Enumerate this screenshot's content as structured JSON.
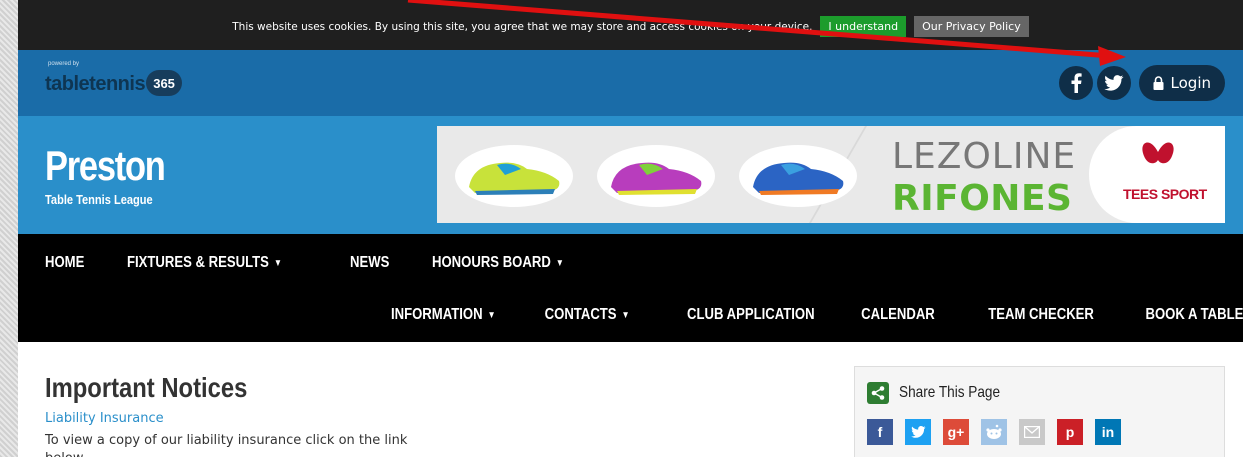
{
  "cookie_bar": {
    "message": "This website uses cookies. By using this site, you agree that we may store and access cookies on your device.",
    "accept_label": "I understand",
    "privacy_label": "Our Privacy Policy"
  },
  "topbar": {
    "brand_small": "powered by",
    "brand_name": "tabletennis",
    "brand_badge": "365",
    "social": [
      {
        "icon": "facebook-icon",
        "glyph": "f"
      },
      {
        "icon": "twitter-icon",
        "glyph": ""
      }
    ],
    "login_label": "Login"
  },
  "header": {
    "title": "Preston",
    "subtitle": "Table Tennis League",
    "banner": {
      "brand_line1": "LEZOLINE",
      "brand_line2": "RIFONES",
      "sponsor": "TEES SPORT"
    }
  },
  "nav": {
    "row1": [
      {
        "label": "HOME",
        "dropdown": false
      },
      {
        "label": "FIXTURES & RESULTS",
        "dropdown": true
      },
      {
        "label": "NEWS",
        "dropdown": false
      },
      {
        "label": "HONOURS BOARD",
        "dropdown": true
      }
    ],
    "row2": [
      {
        "label": "INFORMATION",
        "dropdown": true
      },
      {
        "label": "CONTACTS",
        "dropdown": true
      },
      {
        "label": "CLUB APPLICATION",
        "dropdown": false
      },
      {
        "label": "CALENDAR",
        "dropdown": false
      },
      {
        "label": "TEAM CHECKER",
        "dropdown": false
      },
      {
        "label": "BOOK A TABLE",
        "dropdown": false
      }
    ]
  },
  "content": {
    "title": "Important Notices",
    "link": "Liability Insurance",
    "text": "To view a copy of our liability insurance click on the link below."
  },
  "share": {
    "title": "Share This Page",
    "buttons": [
      {
        "icon": "facebook-icon",
        "glyph": "f",
        "color": "#3b5998"
      },
      {
        "icon": "twitter-icon",
        "glyph": "t",
        "color": "#1da1f2"
      },
      {
        "icon": "google-plus-icon",
        "glyph": "g+",
        "color": "#dd4b39"
      },
      {
        "icon": "reddit-icon",
        "glyph": "r",
        "color": "#9fc3e6"
      },
      {
        "icon": "email-icon",
        "glyph": "✉",
        "color": "#c9c9c9"
      },
      {
        "icon": "pinterest-icon",
        "glyph": "p",
        "color": "#cb2027"
      },
      {
        "icon": "linkedin-icon",
        "glyph": "in",
        "color": "#0077b5"
      }
    ]
  },
  "colors": {
    "topbar": "#1a6ca8",
    "header": "#2a8fca",
    "nav": "#000000",
    "annotation_arrow": "#e01010"
  }
}
